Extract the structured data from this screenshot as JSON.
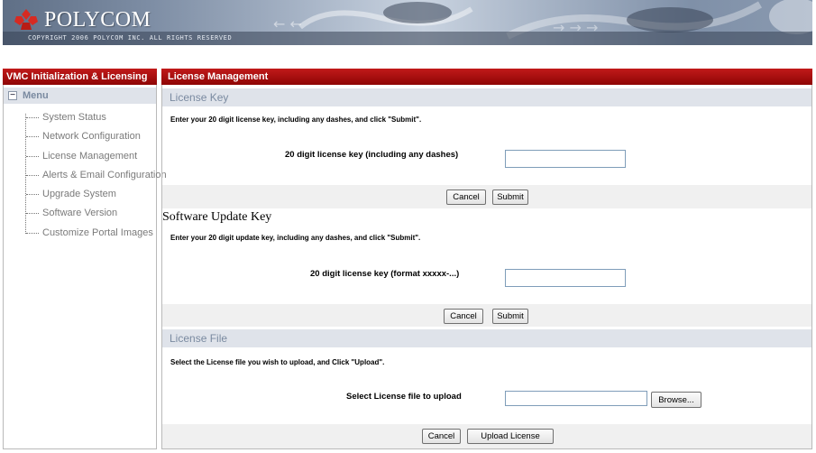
{
  "banner": {
    "brand": "POLYCOM",
    "copyright": "COPYRIGHT 2006 POLYCOM INC. ALL RIGHTS RESERVED",
    "colors": {
      "brand_red": "#c8251f",
      "header_red": "#a30a0a"
    }
  },
  "sidebar": {
    "title": "VMC Initialization & Licensing",
    "menu_label": "Menu",
    "collapse_glyph": "−",
    "items": [
      {
        "label": "System Status"
      },
      {
        "label": "Network Configuration"
      },
      {
        "label": "License Management"
      },
      {
        "label": "Alerts & Email Configuration"
      },
      {
        "label": "Upgrade System"
      },
      {
        "label": "Software Version"
      },
      {
        "label": "Customize Portal Images"
      }
    ]
  },
  "main": {
    "title": "License Management",
    "license_key": {
      "heading": "License Key",
      "instructions": "Enter your 20 digit license key, including any dashes, and click \"Submit\".",
      "field_label": "20 digit license key (including any dashes)",
      "value": "",
      "cancel_label": "Cancel",
      "submit_label": "Submit"
    },
    "update_key": {
      "heading": "Software Update Key",
      "instructions": "Enter your 20 digit update key, including any dashes, and click \"Submit\".",
      "field_label": "20 digit license key (format xxxxx-...)",
      "value": "",
      "cancel_label": "Cancel",
      "submit_label": "Submit"
    },
    "license_file": {
      "heading": "License File",
      "instructions": "Select the License file you wish to upload, and Click \"Upload\".",
      "field_label": "Select License file to upload",
      "value": "",
      "browse_label": "Browse...",
      "cancel_label": "Cancel",
      "upload_label": "Upload License"
    }
  }
}
